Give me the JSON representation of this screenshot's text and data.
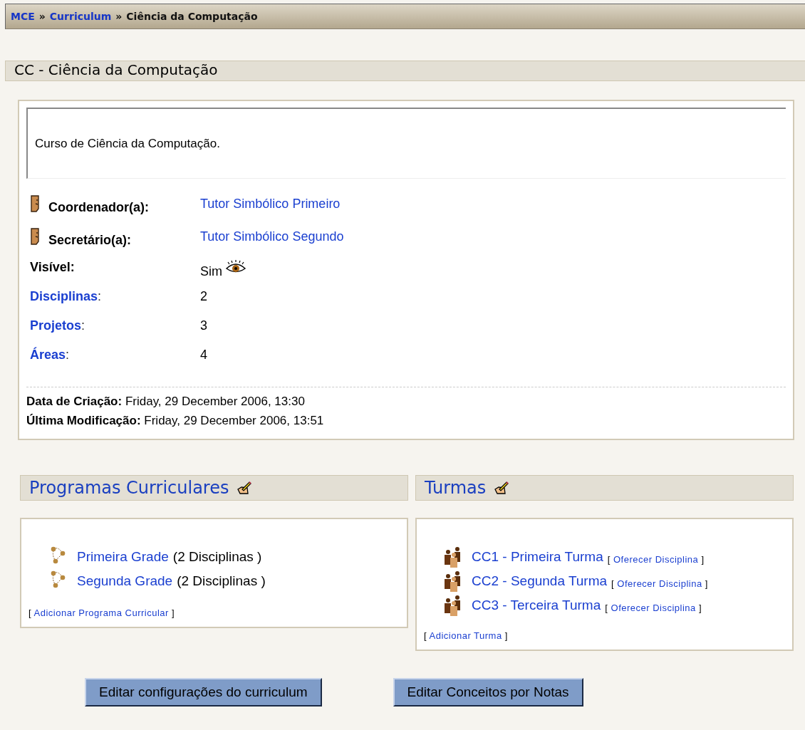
{
  "breadcrumb": {
    "separator": "»",
    "items": [
      {
        "label": "MCE",
        "kind": "link"
      },
      {
        "label": "Curriculum",
        "kind": "link"
      },
      {
        "label": "Ciência da Computação",
        "kind": "current"
      }
    ]
  },
  "title": "CC - Ciência da Computação",
  "summary": {
    "description": "Curso de Ciência da Computação.",
    "rows": [
      {
        "kind": "person",
        "label": "Coordenador(a):",
        "value": "Tutor Simbólico Primeiro"
      },
      {
        "kind": "person",
        "label": "Secretário(a):",
        "value": "Tutor Simbólico Segundo"
      },
      {
        "kind": "visibility",
        "label": "Visível:",
        "value": "Sim"
      },
      {
        "kind": "count",
        "label": "Disciplinas",
        "suffix": ":",
        "value": "2"
      },
      {
        "kind": "count",
        "label": "Projetos",
        "suffix": ":",
        "value": "3"
      },
      {
        "kind": "count",
        "label": "Áreas",
        "suffix": ":",
        "value": "4"
      }
    ],
    "dates": [
      {
        "label": "Data de Criação:",
        "value": "Friday, 29 December 2006, 13:30"
      },
      {
        "label": "Última Modificação:",
        "value": "Friday, 29 December 2006, 13:51"
      }
    ]
  },
  "panels": [
    {
      "kind": "programs",
      "title": "Programas Curriculares",
      "items": [
        {
          "label": "Primeira Grade",
          "note": "(2 Disciplinas )"
        },
        {
          "label": "Segunda Grade",
          "note": "(2 Disciplinas )"
        }
      ],
      "add": {
        "open": "[",
        "label": "Adicionar Programa Curricular",
        "close": "]"
      }
    },
    {
      "kind": "classes",
      "title": "Turmas",
      "items": [
        {
          "label": "CC1 - Primeira Turma",
          "action": {
            "open": "[",
            "label": "Oferecer Disciplina",
            "close": "]"
          }
        },
        {
          "label": "CC2 - Segunda Turma",
          "action": {
            "open": "[",
            "label": "Oferecer Disciplina",
            "close": "]"
          }
        },
        {
          "label": "CC3 - Terceira Turma",
          "action": {
            "open": "[",
            "label": "Oferecer Disciplina",
            "close": "]"
          }
        }
      ],
      "add": {
        "open": "[",
        "label": "Adicionar Turma",
        "close": "]"
      }
    }
  ],
  "buttons": [
    "Editar configurações do curriculum",
    "Editar Conceitos por Notas"
  ]
}
